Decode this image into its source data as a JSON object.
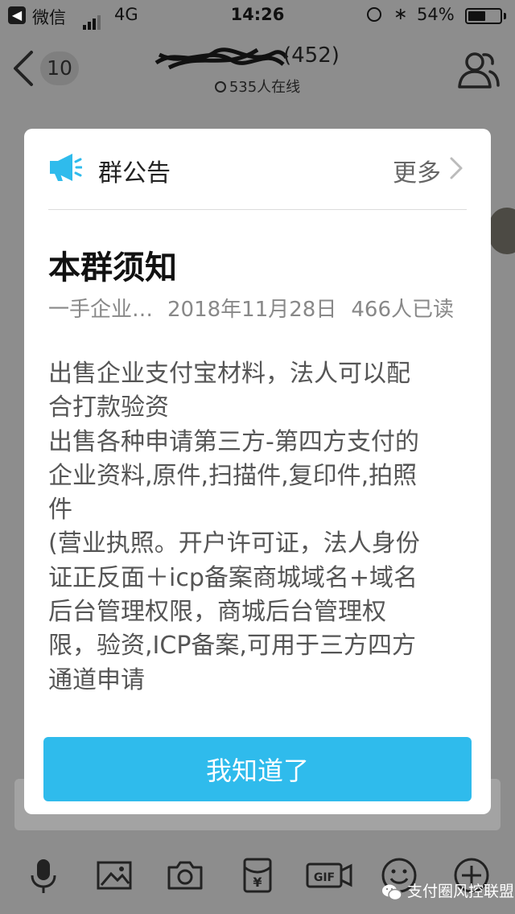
{
  "status_bar": {
    "back_label": "微信",
    "network": "4G",
    "time": "14:26",
    "battery_percent": "54%",
    "battery_level": 0.54
  },
  "nav": {
    "unread_count": "10",
    "title_suffix": "(452)",
    "online_text": "535人在线"
  },
  "modal": {
    "header_title": "群公告",
    "more_label": "更多",
    "notice_title": "本群须知",
    "author": "一手企业…",
    "date": "2018年11月28日",
    "read_count": "466人已读",
    "body_lines": [
      "出售企业支付宝材料，法人可以配",
      "合打款验资",
      "出售各种申请第三方-第四方支付的",
      "企业资料,原件,扫描件,复印件,拍照",
      "件",
      "(营业执照。开户许可证，法人身份",
      "证正反面＋icp备案商城域名+域名",
      "后台管理权限，商城后台管理权",
      "限，验资,ICP备案,可用于三方四方",
      "通道申请"
    ],
    "confirm_label": "我知道了"
  },
  "toolbar": {
    "icons": [
      "microphone-icon",
      "image-icon",
      "camera-icon",
      "red-packet-icon",
      "gif-icon",
      "emoji-icon",
      "plus-icon"
    ],
    "red_packet_symbol": "¥",
    "gif_label": "GIF"
  },
  "watermark": {
    "text": "支付圈风控联盟"
  },
  "colors": {
    "accent": "#2fbbec",
    "overlay": "#8d8d8d",
    "modal_bg": "#ffffff"
  }
}
